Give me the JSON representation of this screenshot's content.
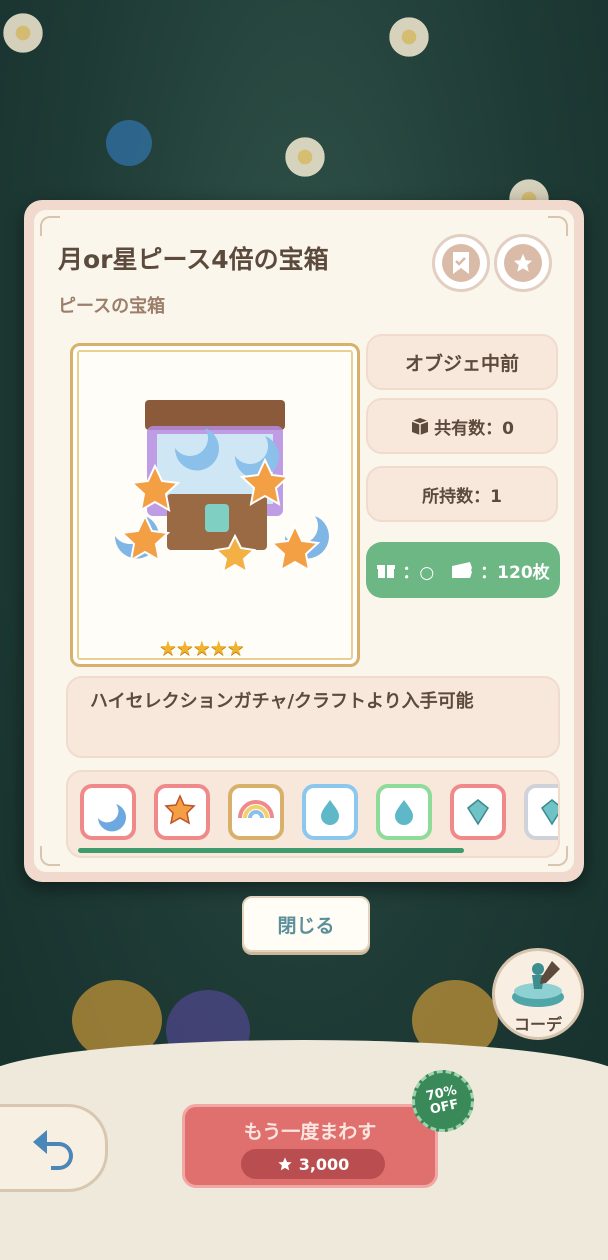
{
  "item": {
    "title": "月or星ピース4倍の宝箱",
    "category": "ピースの宝箱",
    "rarity_stars": "★★★★★",
    "rarity": 5,
    "description": "ハイセレクションガチャ/クラフトより入手可能"
  },
  "info": {
    "position_label": "オブジェ中前",
    "shared_count": "共有数：0",
    "owned_count": "所持数：1",
    "gift_label": "：○",
    "ticket_label": "：120枚"
  },
  "header_buttons": {
    "bookmark_icon": "bookmark-check-icon",
    "favorite_icon": "star-icon"
  },
  "variants": [
    {
      "icon": "moon-icon",
      "border": "#f08a8a"
    },
    {
      "icon": "star-icon",
      "border": "#f08a8a"
    },
    {
      "icon": "rainbow-icon",
      "border": "#d7b16b"
    },
    {
      "icon": "water-drop-icon",
      "border": "#8cc8ee"
    },
    {
      "icon": "water-drop-icon",
      "border": "#8fdc9a"
    },
    {
      "icon": "gem-icon",
      "border": "#f08a8a"
    },
    {
      "icon": "gem-icon",
      "border": "#cfd2d8"
    }
  ],
  "buttons": {
    "close": "閉じる",
    "coordinate": "コーデ",
    "spin_again": "もう一度まわす",
    "spin_cost": "3,000",
    "discount_top": "70%",
    "discount_bottom": "OFF"
  },
  "colors": {
    "accent_green": "#6cb784",
    "spin_red": "#e0706e",
    "gold_frame": "#d7b16b"
  }
}
